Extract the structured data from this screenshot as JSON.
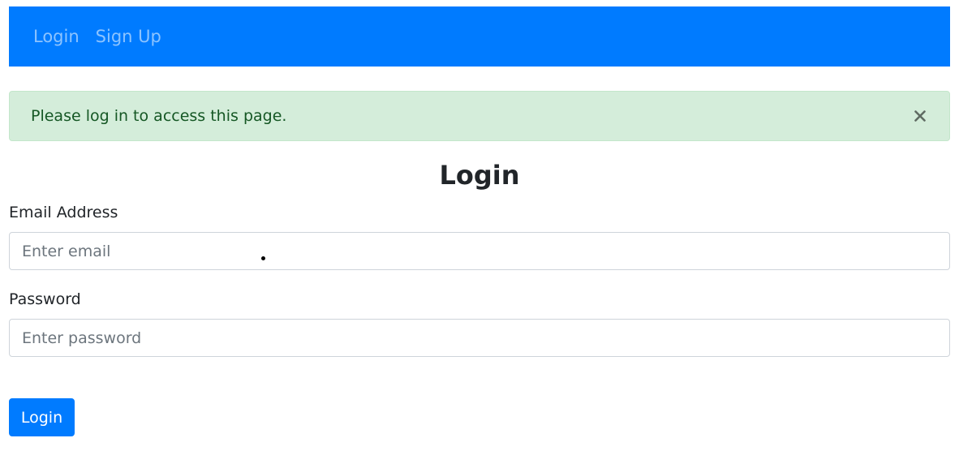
{
  "navbar": {
    "links": [
      {
        "label": "Login"
      },
      {
        "label": "Sign Up"
      }
    ],
    "background_color": "#007bff"
  },
  "alert": {
    "message": "Please log in to access this page.",
    "close_symbol": "×",
    "type": "success"
  },
  "form": {
    "title": "Login",
    "email": {
      "label": "Email Address",
      "placeholder": "Enter email",
      "value": ""
    },
    "password": {
      "label": "Password",
      "placeholder": "Enter password",
      "value": ""
    },
    "submit_label": "Login"
  },
  "colors": {
    "primary": "#007bff",
    "alert_bg": "#d4edda",
    "alert_text": "#155724"
  }
}
